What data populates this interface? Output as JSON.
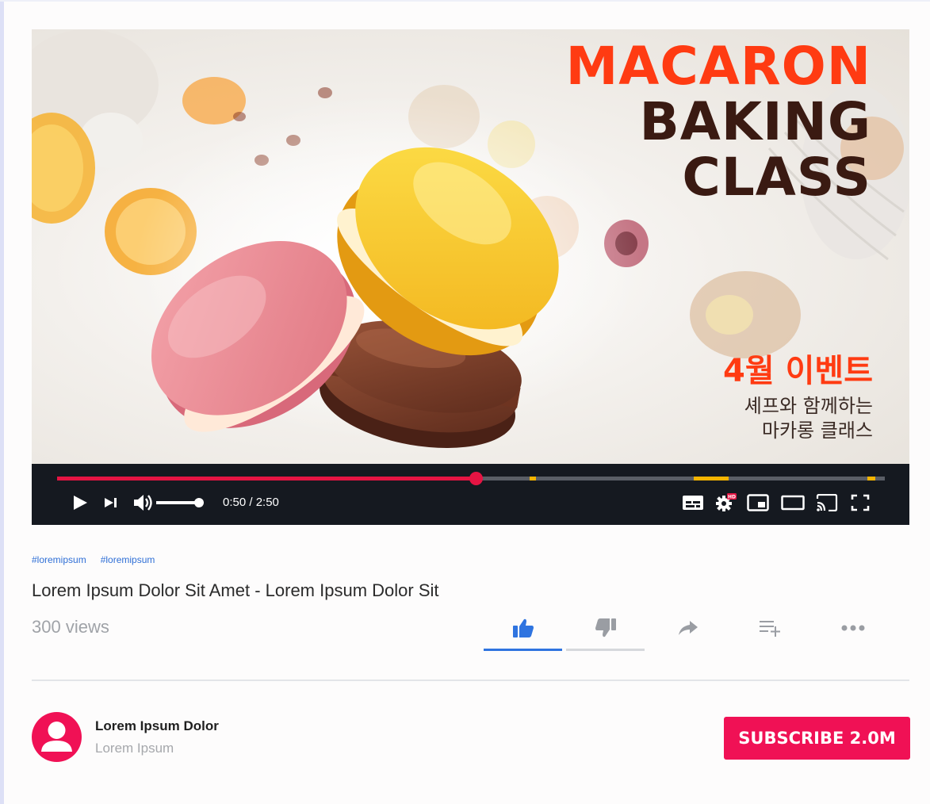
{
  "video": {
    "thumbnail_title_line1": "MACARON",
    "thumbnail_title_line2": "BAKING",
    "thumbnail_title_line3": "CLASS",
    "thumbnail_event": "4월 이벤트",
    "thumbnail_subtitle_line1": "셰프와 함께하는",
    "thumbnail_subtitle_line2": "마카롱 클래스",
    "colors": {
      "title_accent": "#ff3b12",
      "title_dark": "#3a1a12"
    }
  },
  "player": {
    "time_display": "0:50 / 2:50",
    "progress_fraction": 0.506,
    "colors": {
      "progress": "#e51443",
      "chapter_marker": "#f5b400",
      "bar_background": "#151920"
    },
    "icons": [
      "play-icon",
      "next-icon",
      "volume-icon",
      "subtitles-icon",
      "settings-hd-icon",
      "miniplayer-icon",
      "theater-mode-icon",
      "cast-icon",
      "fullscreen-icon"
    ]
  },
  "meta": {
    "tags": [
      "#loremipsum",
      "#loremipsum"
    ],
    "title": "Lorem Ipsum Dolor Sit Amet - Lorem Ipsum Dolor Sit",
    "views": "300 views",
    "actions": [
      "thumbs-up-icon",
      "thumbs-down-icon",
      "share-icon",
      "add-to-playlist-icon",
      "more-icon"
    ],
    "colors": {
      "like_active": "#2f74e0",
      "inactive_icon": "#9a9da3"
    }
  },
  "channel": {
    "name": "Lorem Ipsum Dolor",
    "subtitle": "Lorem Ipsum",
    "subscribe_label": "SUBSCRIBE 2.0M",
    "colors": {
      "brand": "#f01155"
    }
  }
}
